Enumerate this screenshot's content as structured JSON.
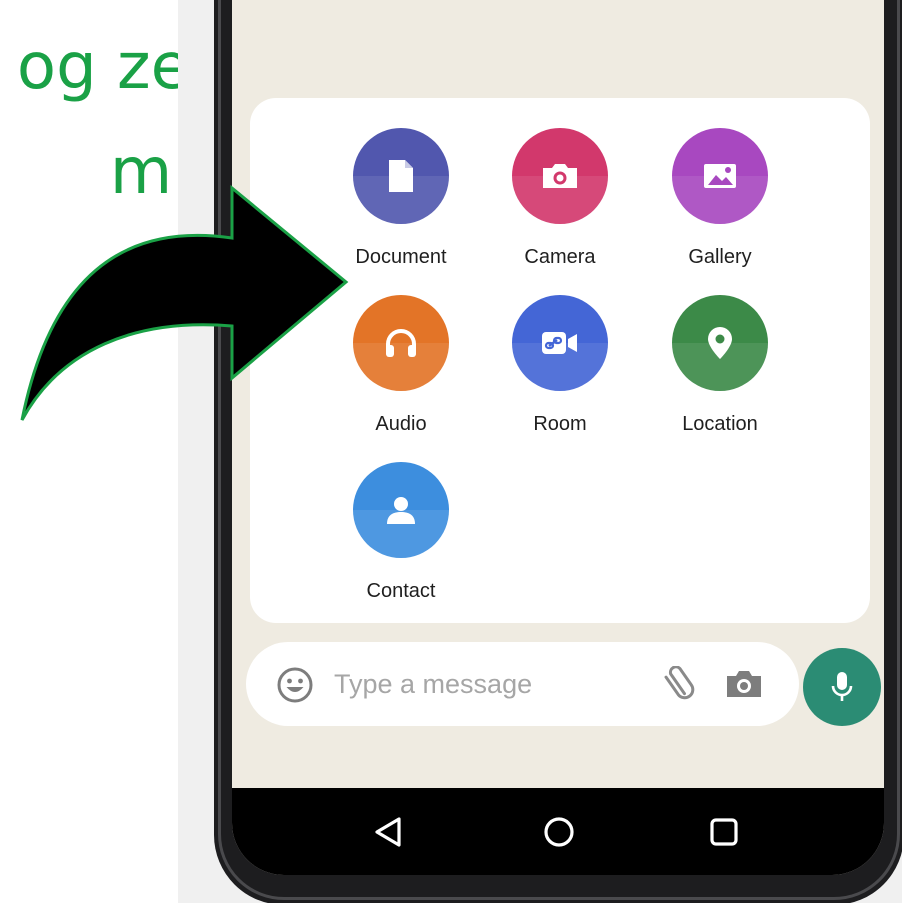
{
  "overlay": {
    "line1": "og ze",
    "line2": "mi"
  },
  "attach_menu": {
    "items": [
      {
        "label": "Document",
        "icon": "document-icon",
        "color": "#5157ae"
      },
      {
        "label": "Camera",
        "icon": "camera-icon",
        "color": "#d2386c"
      },
      {
        "label": "Gallery",
        "icon": "gallery-icon",
        "color": "#a848c0"
      },
      {
        "label": "Audio",
        "icon": "headphones-icon",
        "color": "#e37427"
      },
      {
        "label": "Room",
        "icon": "room-video-icon",
        "color": "#4466d6"
      },
      {
        "label": "Location",
        "icon": "location-pin-icon",
        "color": "#3c8a48"
      },
      {
        "label": "Contact",
        "icon": "contact-icon",
        "color": "#3d8ede"
      }
    ]
  },
  "message_bar": {
    "placeholder": "Type a message",
    "icons": [
      "emoji-icon",
      "paperclip-icon",
      "camera-icon"
    ]
  },
  "mic_button": {
    "icon": "mic-icon",
    "color": "#2b8c74"
  },
  "nav_bar": {
    "icons": [
      "back-icon",
      "home-icon",
      "recents-icon"
    ]
  },
  "colors": {
    "overlay_text": "#1aa146",
    "screen_bg": "#efebe1",
    "panel_bg": "#ffffff"
  }
}
